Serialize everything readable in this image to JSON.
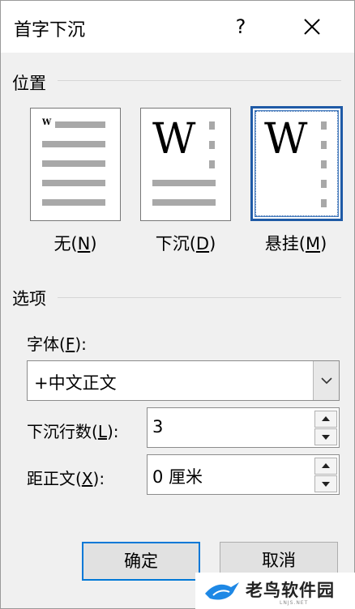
{
  "dialog": {
    "title": "首字下沉",
    "help_label": "?"
  },
  "position": {
    "group_label": "位置",
    "options": [
      {
        "label_main": "无(",
        "label_key": "N",
        "label_end": ")",
        "selected": false
      },
      {
        "label_main": "下沉(",
        "label_key": "D",
        "label_end": ")",
        "selected": false
      },
      {
        "label_main": "悬挂(",
        "label_key": "M",
        "label_end": ")",
        "selected": true
      }
    ],
    "preview_letter": "W"
  },
  "options": {
    "group_label": "选项",
    "font": {
      "label_main": "字体(",
      "label_key": "F",
      "label_end": "):",
      "value": "+中文正文"
    },
    "lines_to_drop": {
      "label_main": "下沉行数(",
      "label_key": "L",
      "label_end": "):",
      "value": "3"
    },
    "distance_from_text": {
      "label_main": "距正文(",
      "label_key": "X",
      "label_end": "):",
      "value": "0 厘米"
    }
  },
  "buttons": {
    "ok": "确定",
    "cancel": "取消"
  },
  "watermark": {
    "text": "老鸟软件园",
    "sub": "LNJS.NET"
  },
  "colors": {
    "selection_border": "#1f5aa6",
    "default_button_border": "#0078d7",
    "preview_bar": "#a8a8a8"
  }
}
